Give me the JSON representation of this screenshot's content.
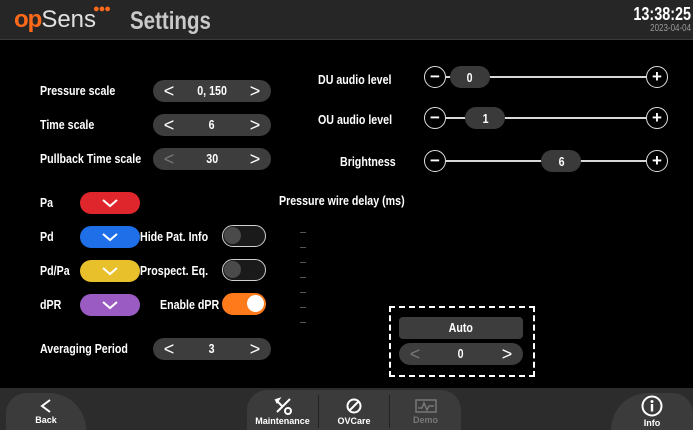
{
  "header": {
    "logo_op": "op",
    "logo_sens": "Sens",
    "title": "Settings",
    "time": "13:38:25",
    "date": "2023-04-04"
  },
  "left": {
    "pressure_scale": {
      "label": "Pressure scale",
      "value": "0, 150"
    },
    "time_scale": {
      "label": "Time scale",
      "value": "6"
    },
    "pullback_time_scale": {
      "label": "Pullback Time scale",
      "value": "30"
    },
    "pa": {
      "label": "Pa",
      "color": "#e0262d"
    },
    "pd": {
      "label": "Pd",
      "color": "#1e6fe8"
    },
    "pdpa": {
      "label": "Pd/Pa",
      "color": "#e8c02c"
    },
    "dpr": {
      "label": "dPR",
      "color": "#9a5cc2"
    },
    "hide_pat_info": {
      "label": "Hide Pat. Info",
      "on": false
    },
    "prospect_eq": {
      "label": "Prospect. Eq.",
      "on": false
    },
    "enable_dpr": {
      "label": "Enable dPR",
      "on": true
    },
    "averaging_period": {
      "label": "Averaging Period",
      "value": "3"
    }
  },
  "right": {
    "du_audio_level": {
      "label": "DU audio level",
      "value": "0",
      "level": 0.0
    },
    "ou_audio_level": {
      "label": "OU audio level",
      "value": "1",
      "level": 0.1
    },
    "brightness": {
      "label": "Brightness",
      "value": "6",
      "level": 0.6
    },
    "pressure_wire_delay": {
      "label": "Pressure wire delay (ms)",
      "auto_label": "Auto",
      "value": "0"
    }
  },
  "footer": {
    "back": "Back",
    "maintenance": "Maintenance",
    "ovc": "OVCare",
    "demo": "Demo",
    "info": "Info"
  },
  "icons": {
    "prev": "chevron-left-icon",
    "next": "chevron-right-icon",
    "dropdown": "chevron-down-icon"
  },
  "colors": {
    "accent": "#ff7a1a",
    "header_bg": "#262626",
    "control_bg": "#3d3d3d"
  }
}
